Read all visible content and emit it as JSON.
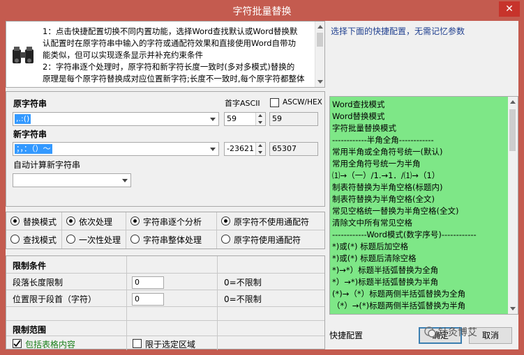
{
  "window": {
    "title": "字符批量替换",
    "close": "✕"
  },
  "tips": {
    "lines": [
      "1：点击快捷配置切换不同内置功能，选择Word查找默认或Word替换默",
      "认配置时在原字符串中输入的字符或通配符效果和直接使用Word自带功",
      "能类似，但可以实现逐条显示并补充约束条件",
      "2：字符串逐个处理时，原字符和新字符长度一致时(多对多模式)替换的",
      "原理是每个原字符替换成对应位置新字符;长度不一致时,每个原字符都整体"
    ]
  },
  "hint": "选择下面的快捷配置，无需记忆参数",
  "source": {
    "label": "原字符串",
    "value": ",.:()",
    "ascii_label": "首字ASCII",
    "ascii_value": "59",
    "ascw_label": "ASCW/HEX",
    "hex_value": "59"
  },
  "target": {
    "label": "新字符串",
    "value": "；，：（）～",
    "ascii_value": "-23621",
    "hex_value": "65307"
  },
  "auto_label": "自动计算新字符串",
  "modes": {
    "row1": [
      "替换模式",
      "依次处理",
      "字符串逐个分析",
      "原字符不使用通配符"
    ],
    "row2": [
      "查找模式",
      "一次性处理",
      "字符串整体处理",
      "原字符使用通配符"
    ]
  },
  "limits": {
    "header": "限制条件",
    "rows": [
      {
        "label": "段落长度限制",
        "value": "0",
        "note": "0=不限制"
      },
      {
        "label": "位置限于段首（字符）",
        "value": "0",
        "note": "0=不限制"
      }
    ]
  },
  "scope": {
    "header": "限制范围",
    "include_table": "包括表格内容",
    "selection_only": "限于选定区域"
  },
  "quick_list": [
    "Word查找模式",
    "Word替换模式",
    "字符批量替换模式",
    "------------半角全角------------",
    "常用半角或全角符号统一(默认)",
    "常用全角符号统一为半角",
    "⑴→（一）/1.→1．/⑴→（1）",
    "制表符替换为半角空格(标题内)",
    "制表符替换为半角空格(全文)",
    "常见空格统一替换为半角空格(全文)",
    "清除文中所有常见空格",
    "------------Word模式(数字序号)------------",
    "*)或(*) 标题后加空格",
    "*)或(*) 标题后清除空格",
    "*)→*）标题半括弧替换为全角",
    "*）→*)标题半括弧替换为半角",
    "(*)→（*）标题两侧半括弧替换为全角",
    "（*）→(*)标题两侧半括弧替换为半角"
  ],
  "quick_label": "快捷配置",
  "buttons": {
    "ok": "确定",
    "cancel": "取消"
  },
  "watermark": "针灸博艾",
  "colors": {
    "titlebar": "#c45b4f",
    "list_bg": "#7ee787",
    "selection": "#3399ff"
  }
}
